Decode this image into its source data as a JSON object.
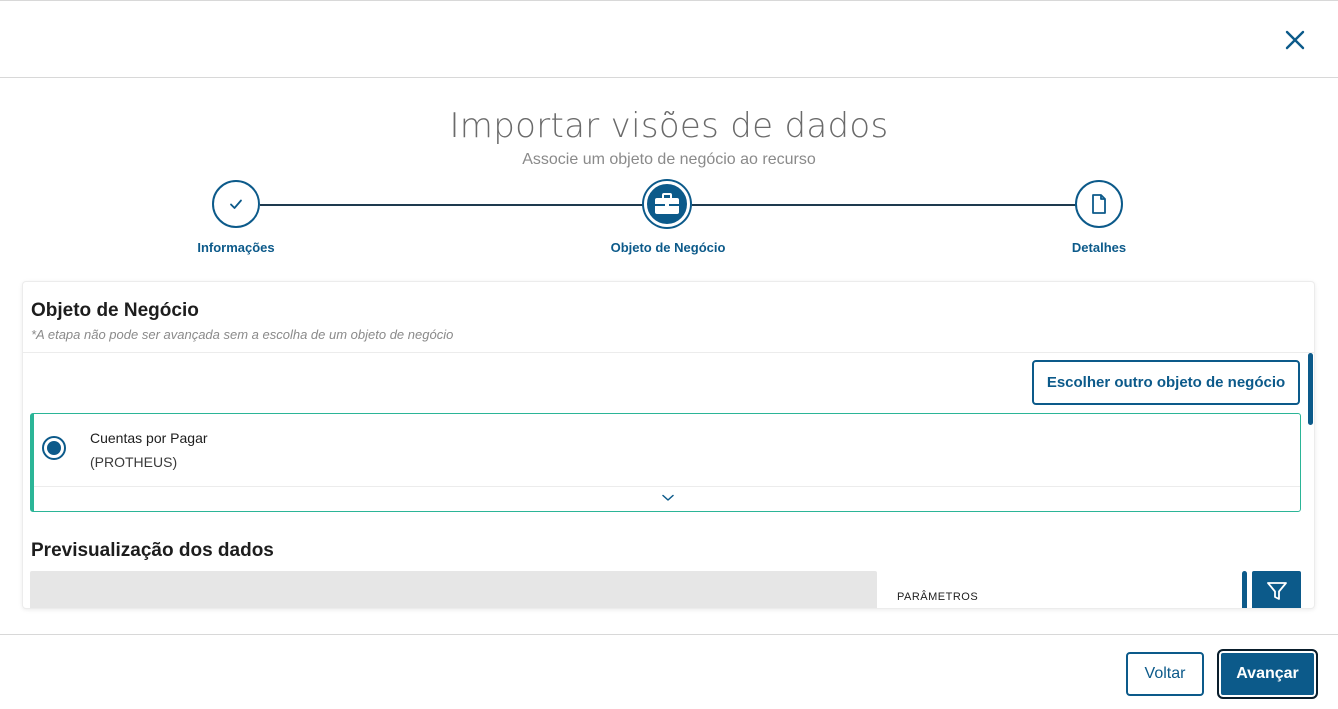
{
  "header": {
    "title": "Importar visões de dados",
    "subtitle": "Associe um objeto de negócio ao recurso"
  },
  "stepper": {
    "steps": [
      {
        "label": "Informações",
        "icon": "check-icon",
        "state": "done"
      },
      {
        "label": "Objeto de Negócio",
        "icon": "briefcase-icon",
        "state": "active"
      },
      {
        "label": "Detalhes",
        "icon": "document-icon",
        "state": "pending"
      }
    ]
  },
  "business_object": {
    "title": "Objeto de Negócio",
    "hint": "*A etapa não pode ser avançada sem a escolha de um objeto de negócio",
    "choose_button": "Escolher outro objeto de negócio",
    "selected": {
      "name": "Cuentas por Pagar",
      "source": "(PROTHEUS)",
      "checked": true
    }
  },
  "preview": {
    "title": "Previsualização dos dados",
    "params_label": "PARÂMETROS"
  },
  "footer": {
    "back_label": "Voltar",
    "next_label": "Avançar"
  },
  "colors": {
    "primary": "#0c5a8a",
    "accent_green": "#2bb597",
    "text_dark": "#1d1d1d",
    "text_muted": "#8a8a8a"
  }
}
